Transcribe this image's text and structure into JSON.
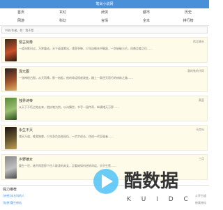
{
  "app_title": "笔尚小说网",
  "nav_rows": [
    [
      "首页",
      "玄幻",
      "武侠",
      "都市",
      "历史"
    ],
    [
      "网游",
      "科幻",
      "言情",
      "全本",
      "排行榜"
    ]
  ],
  "search": {
    "placeholder": "书名/作者，如：我不是"
  },
  "books": [
    {
      "title": "荒古剑尊",
      "author": "西北晴天",
      "desc": "一道光影闪过，万界震动。天下英雄辈出，诸圣争锋，少年自微末中崛起，一剑斩破万古，问鼎至尊之位……",
      "cover_colors": [
        "#3a2a1a",
        "#c8502a",
        "#2a1a10"
      ]
    },
    {
      "title": "混元图",
      "author": "我的铁的代码",
      "desc": "一张神秘古图，从天而降。那一刻起，他的命运彻底改变，踏上一条逆天而行的修炼之路……",
      "cover_colors": [
        "#2a2020",
        "#a0522d",
        "#e0b060"
      ]
    },
    {
      "title": "独界诗帝",
      "author": "黄蓝",
      "desc": "从天下不朽之地走来，他执笔为剑，以诗镇世，书写一段传奇，纵横诸天万界……",
      "cover_colors": [
        "#5a8a3a",
        "#9ac070",
        "#2a4a20"
      ]
    },
    {
      "title": "永生不灭",
      "author": "马克吐",
      "desc": "诸天万道，唯我独尊。少年身负血海深仇，一步步成长，终成一代至强者……",
      "cover_colors": [
        "#1a1410",
        "#6a5a30",
        "#c0a050"
      ]
    },
    {
      "title": "乡野嫡女",
      "author": "三月",
      "desc": "重生一世，她不再是那个任人欺凌的弃女，且看她如何逆转命运，步步生莲……",
      "cover_colors": [
        "#8a8a8a",
        "#c0c0c0",
        "#4a4a4a"
      ]
    }
  ],
  "section": {
    "title": "强力推荐",
    "items": [
      {
        "name": "[诗经]本名叫的人",
        "right": "斗罗古道"
      },
      {
        "name": "[仙侠]重生修仙",
        "right": "修真修仙"
      }
    ]
  },
  "watermark": {
    "text": "酷数据",
    "sub": "K U I D C"
  }
}
